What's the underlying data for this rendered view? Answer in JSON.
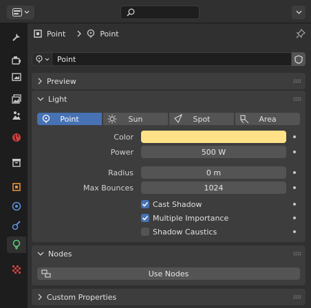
{
  "breadcrumb": {
    "object_name": "Point",
    "data_name": "Point"
  },
  "datablock": {
    "name": "Point"
  },
  "panels": {
    "preview": {
      "title": "Preview"
    },
    "light": {
      "title": "Light",
      "types": [
        "Point",
        "Sun",
        "Spot",
        "Area"
      ],
      "selected_type": "Point",
      "color_label": "Color",
      "color_value": "#ffe287",
      "power_label": "Power",
      "power_value": "500 W",
      "radius_label": "Radius",
      "radius_value": "0 m",
      "max_bounces_label": "Max Bounces",
      "max_bounces_value": "1024",
      "cast_shadow_label": "Cast Shadow",
      "cast_shadow_checked": true,
      "multiple_importance_label": "Multiple Importance",
      "multiple_importance_checked": true,
      "shadow_caustics_label": "Shadow Caustics",
      "shadow_caustics_checked": false
    },
    "nodes": {
      "title": "Nodes",
      "use_nodes_label": "Use Nodes"
    },
    "custom_properties": {
      "title": "Custom Properties"
    }
  },
  "sidebar_tabs": [
    "tool-icon",
    "render-icon",
    "output-icon",
    "view-layer-icon",
    "scene-icon",
    "world-icon",
    "collection-icon",
    "object-icon",
    "physics-icon",
    "constraints-icon",
    "light-data-icon",
    "texture-icon"
  ],
  "active_tab": "light-data-icon",
  "accent_color": "#4772b3"
}
